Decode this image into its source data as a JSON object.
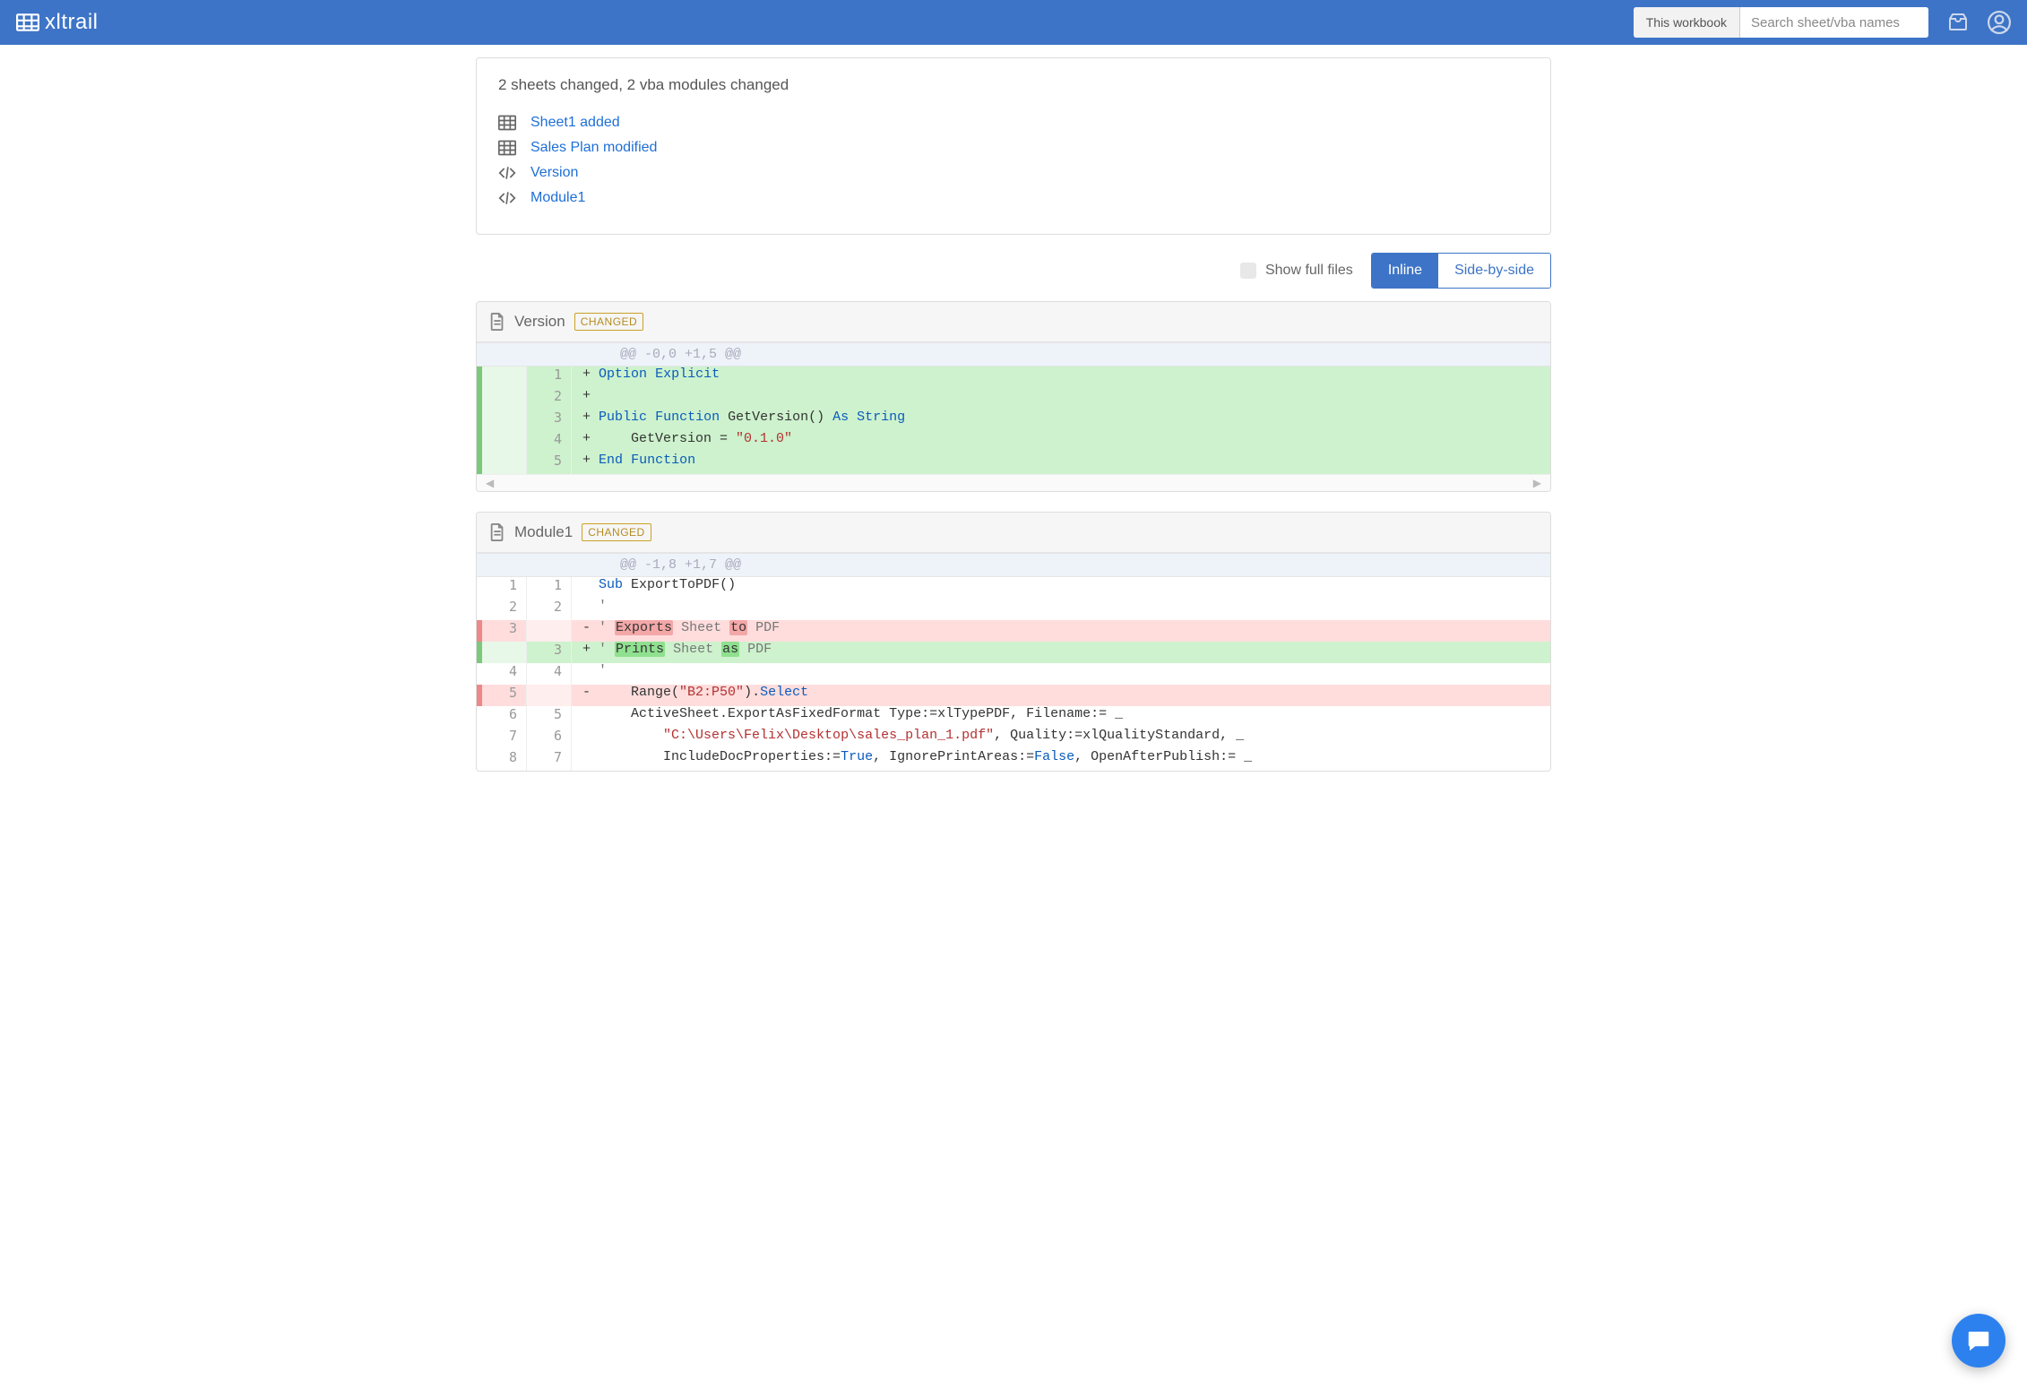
{
  "header": {
    "brand": "xltrail",
    "search_scope": "This workbook",
    "search_placeholder": "Search sheet/vba names"
  },
  "summary": {
    "title": "2 sheets changed, 2 vba modules changed",
    "items": [
      {
        "kind": "sheet",
        "label": "Sheet1 added"
      },
      {
        "kind": "sheet",
        "label": "Sales Plan modified"
      },
      {
        "kind": "code",
        "label": "Version"
      },
      {
        "kind": "code",
        "label": "Module1"
      }
    ]
  },
  "toolbar": {
    "show_full_label": "Show full files",
    "inline_label": "Inline",
    "side_by_side_label": "Side-by-side"
  },
  "diffs": [
    {
      "name": "Version",
      "badge": "CHANGED",
      "hunk_header": "@@ -0,0 +1,5 @@",
      "lines": [
        {
          "type": "add",
          "old": "",
          "new": "1",
          "tokens": [
            [
              "kw",
              "Option"
            ],
            [
              "sp",
              " "
            ],
            [
              "kw",
              "Explicit"
            ]
          ]
        },
        {
          "type": "add",
          "old": "",
          "new": "2",
          "tokens": []
        },
        {
          "type": "add",
          "old": "",
          "new": "3",
          "tokens": [
            [
              "kw",
              "Public"
            ],
            [
              "sp",
              " "
            ],
            [
              "kw",
              "Function"
            ],
            [
              "sp",
              " "
            ],
            [
              "txt",
              "GetVersion() "
            ],
            [
              "kw",
              "As"
            ],
            [
              "sp",
              " "
            ],
            [
              "kw",
              "String"
            ]
          ]
        },
        {
          "type": "add",
          "old": "",
          "new": "4",
          "tokens": [
            [
              "sp",
              "    "
            ],
            [
              "txt",
              "GetVersion = "
            ],
            [
              "str",
              "\"0.1.0\""
            ]
          ]
        },
        {
          "type": "add",
          "old": "",
          "new": "5",
          "tokens": [
            [
              "kw",
              "End"
            ],
            [
              "sp",
              " "
            ],
            [
              "kw",
              "Function"
            ]
          ]
        }
      ]
    },
    {
      "name": "Module1",
      "badge": "CHANGED",
      "hunk_header": "@@ -1,8 +1,7 @@",
      "lines": [
        {
          "type": "ctx",
          "old": "1",
          "new": "1",
          "tokens": [
            [
              "kw",
              "Sub"
            ],
            [
              "sp",
              " "
            ],
            [
              "txt",
              "ExportToPDF()"
            ]
          ]
        },
        {
          "type": "ctx",
          "old": "2",
          "new": "2",
          "tokens": [
            [
              "cm",
              "'"
            ]
          ]
        },
        {
          "type": "del",
          "old": "3",
          "new": "",
          "tokens": [
            [
              "cm",
              "' "
            ],
            [
              "wdel",
              "Exports"
            ],
            [
              "cm",
              " Sheet "
            ],
            [
              "wdel",
              "to"
            ],
            [
              "cm",
              " PDF"
            ]
          ]
        },
        {
          "type": "add",
          "old": "",
          "new": "3",
          "tokens": [
            [
              "cm",
              "' "
            ],
            [
              "wadd",
              "Prints"
            ],
            [
              "cm",
              " Sheet "
            ],
            [
              "wadd",
              "as"
            ],
            [
              "cm",
              " PDF"
            ]
          ]
        },
        {
          "type": "ctx",
          "old": "4",
          "new": "4",
          "tokens": [
            [
              "cm",
              "'"
            ]
          ]
        },
        {
          "type": "del",
          "old": "5",
          "new": "",
          "tokens": [
            [
              "sp",
              "    "
            ],
            [
              "txt",
              "Range("
            ],
            [
              "str",
              "\"B2:P50\""
            ],
            [
              "txt",
              ")."
            ],
            [
              "kw",
              "Select"
            ]
          ]
        },
        {
          "type": "ctx",
          "old": "6",
          "new": "5",
          "tokens": [
            [
              "sp",
              "    "
            ],
            [
              "txt",
              "ActiveSheet.ExportAsFixedFormat Type:=xlTypePDF, Filename:= _"
            ]
          ]
        },
        {
          "type": "ctx",
          "old": "7",
          "new": "6",
          "tokens": [
            [
              "sp",
              "        "
            ],
            [
              "str",
              "\"C:\\Users\\Felix\\Desktop\\sales_plan_1.pdf\""
            ],
            [
              "txt",
              ", Quality:=xlQualityStandard, _"
            ]
          ]
        },
        {
          "type": "ctx",
          "old": "8",
          "new": "7",
          "tokens": [
            [
              "sp",
              "        "
            ],
            [
              "txt",
              "IncludeDocProperties:="
            ],
            [
              "kw",
              "True"
            ],
            [
              "txt",
              ", IgnorePrintAreas:="
            ],
            [
              "kw",
              "False"
            ],
            [
              "txt",
              ", OpenAfterPublish:= _"
            ]
          ]
        }
      ]
    }
  ]
}
